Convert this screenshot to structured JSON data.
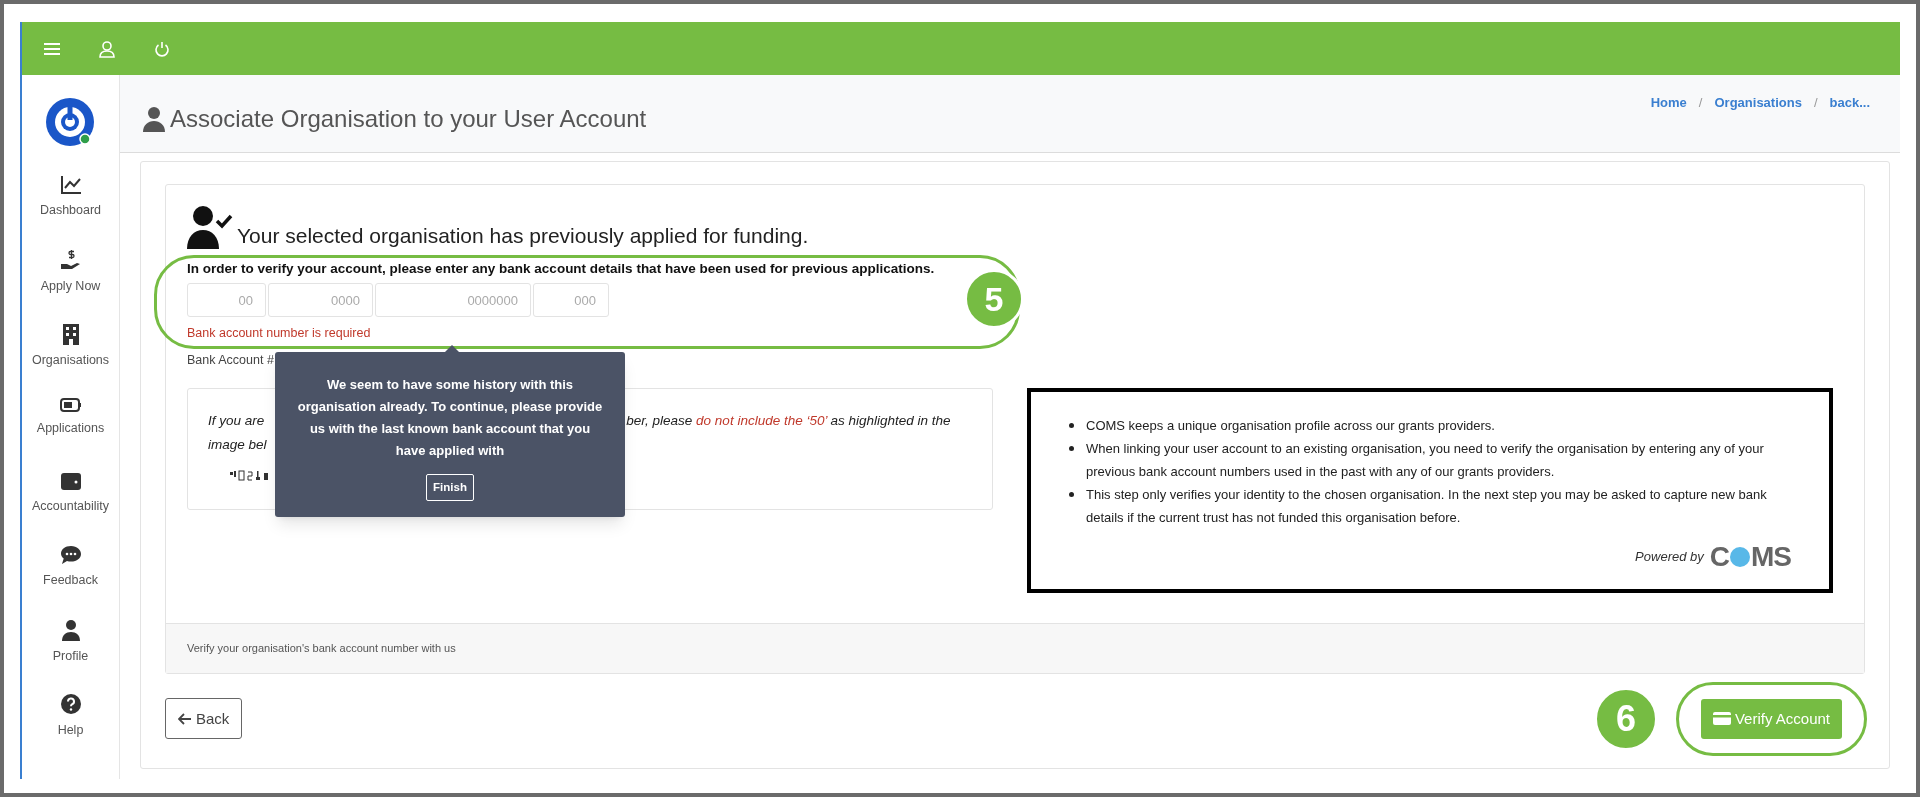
{
  "sidebar": {
    "items": [
      {
        "label": "Dashboard",
        "kind": "chart"
      },
      {
        "label": "Apply Now",
        "kind": "apply"
      },
      {
        "label": "Organisations",
        "kind": "building"
      },
      {
        "label": "Applications",
        "kind": "card"
      },
      {
        "label": "Accountability",
        "kind": "wallet"
      },
      {
        "label": "Feedback",
        "kind": "chat"
      },
      {
        "label": "Profile",
        "kind": "person"
      },
      {
        "label": "Help",
        "kind": "help"
      }
    ]
  },
  "page_header": {
    "title": "Associate Organisation to your User Account",
    "breadcrumbs": [
      "Home",
      "Organisations",
      "back..."
    ],
    "separator": "/"
  },
  "verify_panel": {
    "heading": "Your selected organisation has previously applied for funding.",
    "instruction": "In order to verify your account, please enter any bank account details that have been used for previous applications.",
    "fields": [
      {
        "placeholder": "00"
      },
      {
        "placeholder": "0000"
      },
      {
        "placeholder": "0000000"
      },
      {
        "placeholder": "000"
      }
    ],
    "error": "Bank account number is required",
    "label": "Bank Account #",
    "note": {
      "line1_start": "If you are",
      "line1_end": [
        {
          "text": "ber, please ",
          "kind": "plain"
        },
        {
          "text": "do not include the ‘50’",
          "kind": "warning"
        },
        {
          "text": " as highlighted in the",
          "kind": "plain"
        }
      ],
      "line2": "image bel"
    },
    "footer_note": "Verify your organisation's bank account number with us"
  },
  "info_box": {
    "bullets": [
      "COMS keeps a unique organisation profile across our grants providers.",
      "When linking your user account to an existing organisation, you need to verify the organisation by entering any of your previous bank account numbers used in the past with any of our grants providers.",
      "This step only verifies your identity to the chosen organisation. In the next step you may be asked to capture new bank details if the current trust has not funded this organisation before."
    ],
    "powered_by": "Powered by",
    "logo_parts": [
      "C",
      "MS"
    ]
  },
  "back_button": "Back",
  "verify_button": "Verify Account",
  "tooltip": {
    "text": "We seem to have some history with this organisation already. To continue, please provide us with the last known bank account that you have applied with",
    "button": "Finish"
  },
  "annotations": [
    {
      "number": "5"
    },
    {
      "number": "6"
    }
  ]
}
